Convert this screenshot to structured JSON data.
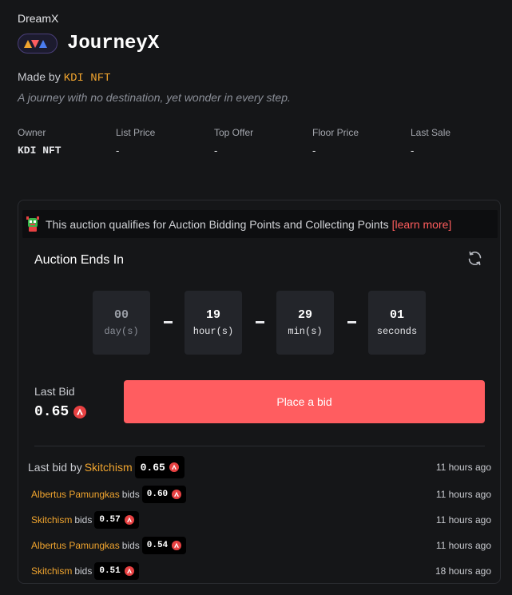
{
  "header": {
    "collection": "DreamX",
    "title": "JourneyX",
    "made_by_label": "Made by",
    "creator": "KDI NFT",
    "tagline": "A journey with no destination, yet wonder in every step."
  },
  "stats": [
    {
      "label": "Owner",
      "value": "KDI NFT"
    },
    {
      "label": "List Price",
      "value": "-"
    },
    {
      "label": "Top Offer",
      "value": "-"
    },
    {
      "label": "Floor Price",
      "value": "-"
    },
    {
      "label": "Last Sale",
      "value": "-"
    }
  ],
  "auction": {
    "banner_text": "This auction qualifies for Auction Bidding Points and Collecting Points",
    "learn_more": "[learn more]",
    "title": "Auction Ends In",
    "countdown": [
      {
        "value": "00",
        "unit": "day(s)"
      },
      {
        "value": "19",
        "unit": "hour(s)"
      },
      {
        "value": "29",
        "unit": "min(s)"
      },
      {
        "value": "01",
        "unit": "seconds"
      }
    ],
    "last_bid_label": "Last Bid",
    "last_bid_value": "0.65",
    "place_bid_label": "Place a bid"
  },
  "bid_history": {
    "last_bid_by_label": "Last bid by",
    "bids_word": "bids",
    "entries": [
      {
        "bidder": "Skitchism",
        "amount": "0.65",
        "time": "11 hours ago"
      },
      {
        "bidder": "Albertus Pamungkas",
        "amount": "0.60",
        "time": "11 hours ago"
      },
      {
        "bidder": "Skitchism",
        "amount": "0.57",
        "time": "11 hours ago"
      },
      {
        "bidder": "Albertus Pamungkas",
        "amount": "0.54",
        "time": "11 hours ago"
      },
      {
        "bidder": "Skitchism",
        "amount": "0.51",
        "time": "18 hours ago"
      }
    ]
  },
  "icons": {
    "currency": "avax-icon",
    "refresh": "refresh-icon",
    "logo": "dreamx-logo-icon",
    "mascot": "points-mascot-icon"
  },
  "colors": {
    "accent": "#ff5d60",
    "creator": "#f0a42e",
    "background": "#151618"
  }
}
